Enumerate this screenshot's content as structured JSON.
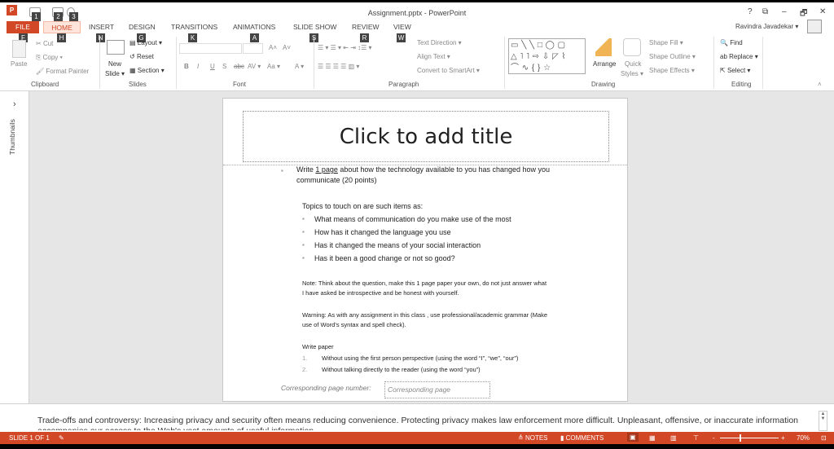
{
  "window": {
    "title": "Assignment.pptx - PowerPoint",
    "help": "?",
    "restore_ribbon": "⧉",
    "minimize": "–",
    "maximize": "🗗",
    "close": "✕",
    "user": "Ravindra Javadekar ▾"
  },
  "qat": {
    "badges": [
      "1",
      "2",
      "3"
    ]
  },
  "tabs": [
    {
      "label": "FILE",
      "key": "F"
    },
    {
      "label": "HOME",
      "key": "H"
    },
    {
      "label": "INSERT",
      "key": "N"
    },
    {
      "label": "DESIGN",
      "key": "G"
    },
    {
      "label": "TRANSITIONS",
      "key": "K"
    },
    {
      "label": "ANIMATIONS",
      "key": "A"
    },
    {
      "label": "SLIDE SHOW",
      "key": "S"
    },
    {
      "label": "REVIEW",
      "key": "R"
    },
    {
      "label": "VIEW",
      "key": "W"
    }
  ],
  "ribbon": {
    "clipboard": {
      "label": "Clipboard",
      "paste": "Paste",
      "cut": "Cut",
      "copy": "Copy ▾",
      "format_painter": "Format Painter"
    },
    "slides": {
      "label": "Slides",
      "new_slide": "New",
      "new_slide2": "Slide ▾",
      "layout": "Layout ▾",
      "reset": "Reset",
      "section": "Section ▾"
    },
    "font": {
      "label": "Font",
      "bold": "B",
      "italic": "I",
      "underline": "U",
      "shadow": "S",
      "strike": "abc",
      "spacing": "AV ▾",
      "case": "Aa ▾",
      "color": "A ▾",
      "grow": "A˄",
      "shrink": "A˅"
    },
    "paragraph": {
      "label": "Paragraph",
      "text_direction": "Text Direction ▾",
      "align_text": "Align Text ▾",
      "smartart": "Convert to SmartArt ▾"
    },
    "drawing": {
      "label": "Drawing",
      "arrange": "Arrange",
      "quick_styles": "Quick",
      "quick_styles2": "Styles ▾",
      "shape_fill": "Shape Fill ▾",
      "shape_outline": "Shape Outline ▾",
      "shape_effects": "Shape Effects ▾",
      "shapes": "▭ ╲ ╲ □ ◯ ▢ △ ˥ ˥ ⇨ ⇩ ◸ ⌇ ⌒ ∿ { } ☆"
    },
    "editing": {
      "label": "Editing",
      "find": "Find",
      "replace": "Replace ▾",
      "select": "Select ▾"
    }
  },
  "thumbnails": {
    "label": "Thumbnails",
    "expand": "›"
  },
  "slide": {
    "title_placeholder": "Click to add title",
    "bullet_pre": "Write ",
    "bullet_u": "1 page",
    "bullet_post": " about how the technology available to you has changed how you",
    "bullet_line2": "communicate (20 points)",
    "topics_heading": "Topics to touch on are such items as:",
    "topics": [
      "What means of communication do you make use of the most",
      "How has it changed the language you use",
      "Has it changed the means of your social interaction",
      "Has it been a good change or not so good?"
    ],
    "note1": "Note: Think about the question, make this 1 page paper your own, do not just answer what",
    "note2": "I have asked be introspective and be honest with yourself.",
    "warn1": "Warning: As with any assignment in this class , use professional/academic grammar (Make",
    "warn2": "use of Word’s syntax and spell check).",
    "write_paper": "Write paper",
    "rules": [
      {
        "n": "1.",
        "t": "Without using the first person perspective (using the word “I”, “we”, “our”)"
      },
      {
        "n": "2.",
        "t": "Without talking directly to the reader (using the word “you”)"
      }
    ],
    "page_label": "Corresponding page number:",
    "page_placeholder": "Corresponding page"
  },
  "notes": {
    "text": "Trade-offs and controversy: Increasing privacy and security often means reducing convenience. Protecting privacy makes law enforcement more difficult. Unpleasant, offensive, or inaccurate information accompanies our access to the Web's vast amounts of useful information."
  },
  "status": {
    "slide": "SLIDE 1 OF 1",
    "notes": "NOTES",
    "comments": "COMMENTS",
    "zoom": "70%",
    "zoom_level": 70
  },
  "colors": {
    "accent": "#D24726"
  }
}
